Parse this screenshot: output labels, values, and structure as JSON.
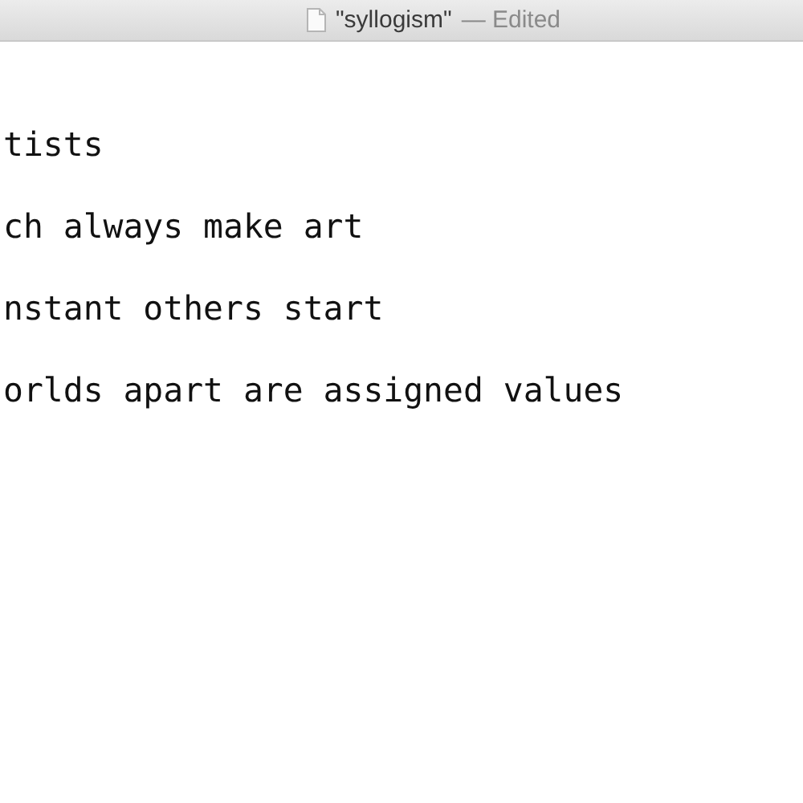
{
  "window": {
    "title": "\"syllogism\"",
    "status": "— Edited"
  },
  "document": {
    "lines": [
      "tists",
      "ch always make art",
      "nstant others start",
      "orlds apart are assigned values"
    ]
  }
}
